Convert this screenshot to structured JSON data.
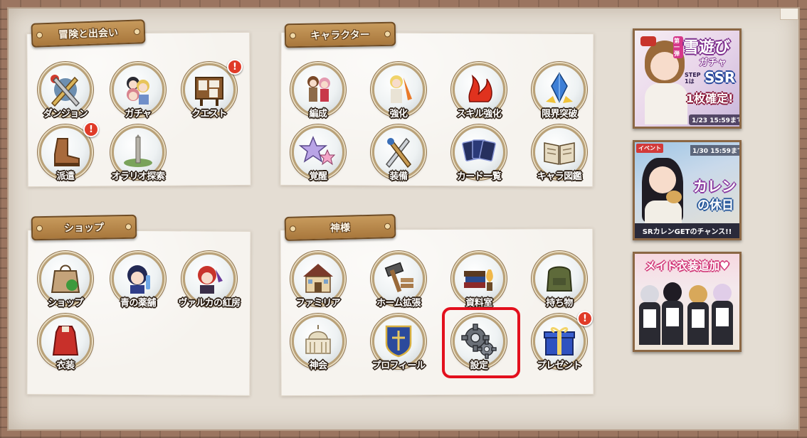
{
  "sections": {
    "adventure": {
      "title": "冒険と出会い"
    },
    "character": {
      "title": "キャラクター"
    },
    "shop": {
      "title": "ショップ"
    },
    "gods": {
      "title": "神様"
    }
  },
  "adventure_items": [
    {
      "label": "ダンジョン",
      "icon": "sword-shield-icon"
    },
    {
      "label": "ガチャ",
      "icon": "gacha-characters-icon"
    },
    {
      "label": "クエスト",
      "icon": "quest-board-icon",
      "badge": "!"
    },
    {
      "label": "派遣",
      "icon": "boot-icon",
      "badge": "!"
    },
    {
      "label": "オラリオ探索",
      "icon": "tower-icon"
    }
  ],
  "character_items": [
    {
      "label": "編成",
      "icon": "party-icon"
    },
    {
      "label": "強化",
      "icon": "enhance-icon"
    },
    {
      "label": "スキル強化",
      "icon": "skill-flame-icon"
    },
    {
      "label": "限界突破",
      "icon": "crystal-icon"
    },
    {
      "label": "覚醒",
      "icon": "stars-icon"
    },
    {
      "label": "装備",
      "icon": "equipment-icon"
    },
    {
      "label": "カード一覧",
      "icon": "cards-icon"
    },
    {
      "label": "キャラ図鑑",
      "icon": "book-icon"
    }
  ],
  "shop_items": [
    {
      "label": "ショップ",
      "icon": "shop-bag-icon"
    },
    {
      "label": "青の薬舗",
      "icon": "blue-pharmacy-icon"
    },
    {
      "label": "ヴァルカの紅房",
      "icon": "crimson-forge-icon"
    },
    {
      "label": "衣装",
      "icon": "costume-icon"
    }
  ],
  "god_items": [
    {
      "label": "ファミリア",
      "icon": "house-icon"
    },
    {
      "label": "ホーム拡張",
      "icon": "hammer-icon"
    },
    {
      "label": "資料室",
      "icon": "archive-icon"
    },
    {
      "label": "持ち物",
      "icon": "backpack-icon"
    },
    {
      "label": "神会",
      "icon": "palace-icon"
    },
    {
      "label": "プロフィール",
      "icon": "emblem-icon"
    },
    {
      "label": "設定",
      "icon": "gear-icon",
      "highlighted": true
    },
    {
      "label": "プレゼント",
      "icon": "gift-icon",
      "badge": "!"
    }
  ],
  "banners": {
    "snow": {
      "tag": "第一弾",
      "title1": "雪遊び",
      "title2": "ガチャ",
      "step": "STEP 1は",
      "ssr": "SSR",
      "confirm": "1枚確定!",
      "date": "1/23 15:59まで"
    },
    "karen": {
      "tag": "イベント",
      "date": "1/30 15:59まで",
      "title1": "カレン",
      "title2": "の休日",
      "footer": "SRカレンGETのチャンス!!"
    },
    "maid": {
      "title": "メイド衣装追加♥"
    }
  },
  "colors": {
    "ribbon": "#b8874a",
    "highlight": "#e3101d",
    "badge": "#e03b28"
  }
}
